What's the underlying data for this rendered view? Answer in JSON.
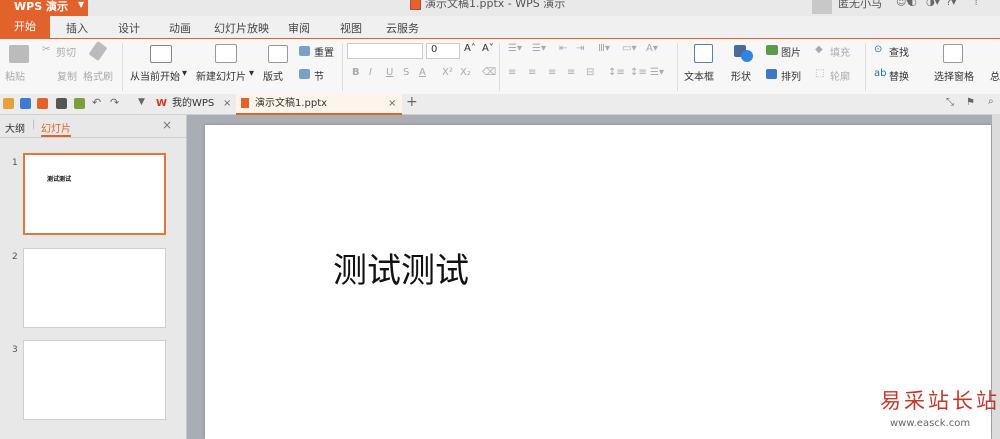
{
  "app": {
    "menu_label": "WPS 演示",
    "window_title": "演示文稿1.pptx - WPS 演示",
    "user_name": "匿无小马"
  },
  "menu_tabs": [
    "开始",
    "插入",
    "设计",
    "动画",
    "幻灯片放映",
    "审阅",
    "视图",
    "云服务"
  ],
  "ribbon": {
    "clipboard": {
      "paste": "粘贴",
      "cut": "剪切",
      "copy": "复制",
      "format_painter": "格式刷"
    },
    "slides": {
      "from_current": "从当前开始",
      "new_slide": "新建幻灯片",
      "layout": "版式",
      "reset": "重置",
      "section": "节"
    },
    "font": {
      "size": "0",
      "bold": "B",
      "italic": "I",
      "underline": "U",
      "strike": "S",
      "color": "A",
      "superscript": "X²",
      "subscript": "X₂"
    },
    "drawing": {
      "textbox": "文本框",
      "shape": "形状",
      "picture": "图片",
      "fill": "填充",
      "arrange": "排列",
      "outline": "轮廓"
    },
    "editing": {
      "find": "查找",
      "replace": "替换",
      "selection_pane": "选择窗格",
      "more": "总"
    }
  },
  "doc_tabs": [
    {
      "label": "我的WPS"
    },
    {
      "label": "演示文稿1.pptx"
    }
  ],
  "panel": {
    "tab_outline": "大纲",
    "tab_slides": "幻灯片"
  },
  "slides": [
    {
      "number": "1",
      "thumb_text": "测试测试"
    },
    {
      "number": "2",
      "thumb_text": ""
    },
    {
      "number": "3",
      "thumb_text": ""
    }
  ],
  "current_slide": {
    "text": "测试测试"
  },
  "watermark": {
    "title": "易采站长站",
    "url": "www.easck.com"
  },
  "colors": {
    "accent": "#e2622c"
  }
}
